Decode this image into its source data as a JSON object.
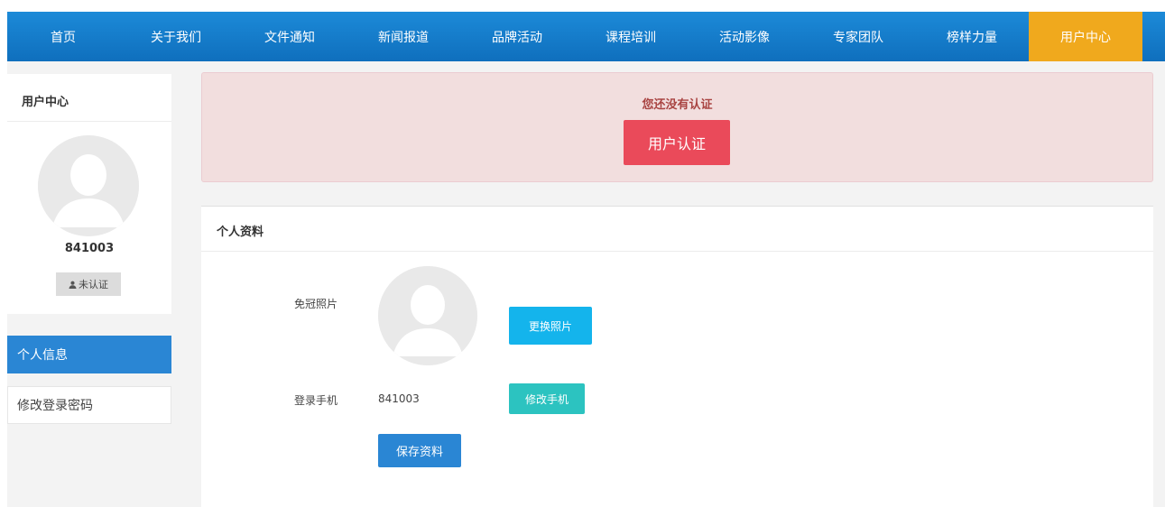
{
  "nav": {
    "items": [
      "首页",
      "关于我们",
      "文件通知",
      "新闻报道",
      "品牌活动",
      "课程培训",
      "活动影像",
      "专家团队",
      "榜样力量",
      "用户中心"
    ],
    "active_index": 9
  },
  "sidebar": {
    "title": "用户中心",
    "user_id": "841003",
    "badge": "未认证",
    "badge_icon": "user-icon",
    "menu": [
      {
        "label": "个人信息",
        "active": true
      },
      {
        "label": "修改登录密码",
        "active": false
      }
    ]
  },
  "alert": {
    "message": "您还没有认证",
    "button": "用户认证"
  },
  "profile": {
    "title": "个人资料",
    "photo_label": "免冠照片",
    "change_photo": "更换照片",
    "phone_label": "登录手机",
    "phone_value": "841003",
    "change_phone": "修改手机",
    "save": "保存资料"
  },
  "colors": {
    "nav_bg": "#1580cf",
    "nav_active": "#f0a91d",
    "alert_bg": "#f2dede",
    "alert_text": "#a94442",
    "alert_button": "#ea4a5a",
    "primary": "#2a86d4",
    "info": "#14b4ec",
    "teal": "#2cc3c0"
  }
}
